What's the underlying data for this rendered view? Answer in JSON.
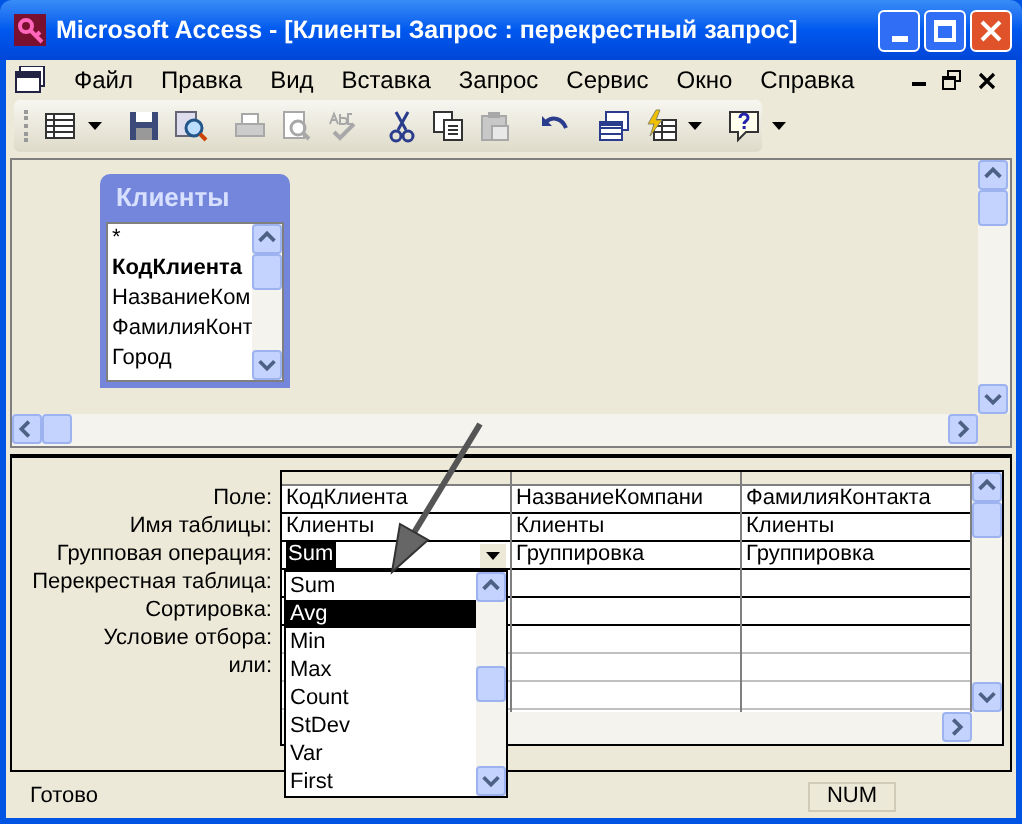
{
  "window": {
    "title": "Microsoft Access - [Клиенты Запрос : перекрестный запрос]"
  },
  "menu": [
    {
      "label": "Файл"
    },
    {
      "label": "Правка"
    },
    {
      "label": "Вид"
    },
    {
      "label": "Вставка"
    },
    {
      "label": "Запрос"
    },
    {
      "label": "Сервис"
    },
    {
      "label": "Окно"
    },
    {
      "label": "Справка"
    }
  ],
  "toolbar": [
    {
      "kind": "view",
      "disabled": false
    },
    {
      "kind": "separator"
    },
    {
      "kind": "save",
      "disabled": false
    },
    {
      "kind": "search",
      "disabled": false
    },
    {
      "kind": "separator"
    },
    {
      "kind": "print",
      "disabled": true
    },
    {
      "kind": "preview",
      "disabled": true
    },
    {
      "kind": "spelling",
      "disabled": true
    },
    {
      "kind": "separator"
    },
    {
      "kind": "cut",
      "disabled": false
    },
    {
      "kind": "copy",
      "disabled": false
    },
    {
      "kind": "paste",
      "disabled": true
    },
    {
      "kind": "separator"
    },
    {
      "kind": "undo",
      "disabled": false
    },
    {
      "kind": "separator"
    },
    {
      "kind": "show-table",
      "disabled": false
    },
    {
      "kind": "query-type",
      "disabled": false
    },
    {
      "kind": "separator"
    },
    {
      "kind": "help",
      "disabled": false
    }
  ],
  "table_box": {
    "title": "Клиенты",
    "fields": [
      {
        "name": "*",
        "bold": false
      },
      {
        "name": "КодКлиента",
        "bold": true
      },
      {
        "name": "НазваниеКом",
        "bold": false
      },
      {
        "name": "ФамилияКонт",
        "bold": false
      },
      {
        "name": "Город",
        "bold": false
      }
    ]
  },
  "grid": {
    "row_labels": [
      "Поле:",
      "Имя таблицы:",
      "Групповая операция:",
      "Перекрестная таблица:",
      "Сортировка:",
      "Условие отбора:",
      "или:"
    ],
    "columns": [
      {
        "field": "КодКлиента",
        "table": "Клиенты",
        "group": "Sum"
      },
      {
        "field": "НазваниеКомпани",
        "table": "Клиенты",
        "group": "Группировка"
      },
      {
        "field": "ФамилияКонтакта",
        "table": "Клиенты",
        "group": "Группировка"
      }
    ]
  },
  "dropdown": {
    "options": [
      {
        "label": "Sum",
        "selected": false
      },
      {
        "label": "Avg",
        "selected": true
      },
      {
        "label": "Min",
        "selected": false
      },
      {
        "label": "Max",
        "selected": false
      },
      {
        "label": "Count",
        "selected": false
      },
      {
        "label": "StDev",
        "selected": false
      },
      {
        "label": "Var",
        "selected": false
      },
      {
        "label": "First",
        "selected": false
      }
    ]
  },
  "status_bar": {
    "text": "Готово",
    "indicators": [
      {
        "label": "NUM"
      }
    ]
  }
}
